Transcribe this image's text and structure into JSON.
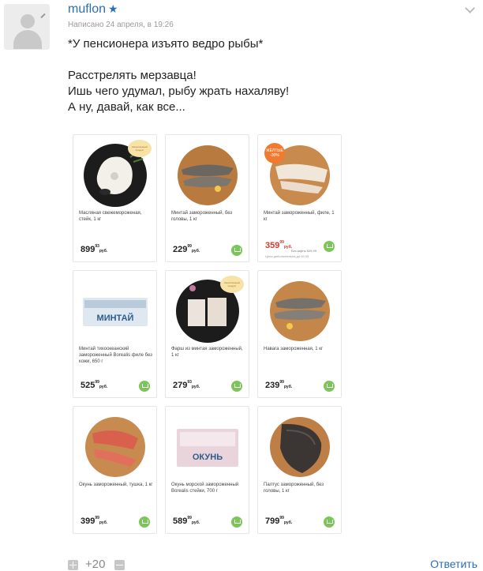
{
  "comment": {
    "author": "muflon",
    "star_icon": "★",
    "meta": "Написано 24 апреля, в 19:26",
    "lines": [
      "*У пенсионера изъято ведро рыбы*",
      "Расстрелять мерзавца!",
      "Ишь чего удумал, рыбу жрать нахаляву!",
      "А ну, давай, как все..."
    ],
    "score": "+20",
    "reply_label": "Ответить"
  },
  "products": [
    {
      "name": "Масляная свежемороженая, стейк, 1 кг",
      "price_main": "899",
      "price_kop": "93",
      "currency": "руб.",
      "tag": "Качественный продукт"
    },
    {
      "name": "Минтай замороженный, без головы, 1 кг",
      "price_main": "229",
      "price_kop": "99",
      "currency": "руб."
    },
    {
      "name": "Минтай замороженный, филе, 1 кг",
      "price_main": "359",
      "price_kop": "99",
      "currency": "руб.",
      "old_price": "Без карты 529,99",
      "note": "Цена действительна до 00.05",
      "badge_top": "ЖЁЛТЫЕ",
      "badge_bottom": "-30%"
    },
    {
      "name": "Минтай тихоокеанский замороженный Borealis филе без кожи, 650 г",
      "price_main": "525",
      "price_kop": "99",
      "currency": "руб.",
      "label": "МИНТАЙ"
    },
    {
      "name": "Фарш из минтая замороженный, 1 кг",
      "price_main": "279",
      "price_kop": "93",
      "currency": "руб.",
      "tag": "Качественный продукт"
    },
    {
      "name": "Навага замороженная, 1 кг",
      "price_main": "239",
      "price_kop": "99",
      "currency": "руб."
    },
    {
      "name": "Окунь замороженный, тушка, 1 кг",
      "price_main": "399",
      "price_kop": "99",
      "currency": "руб."
    },
    {
      "name": "Окунь морской замороженный Borealis стейки, 700 г",
      "price_main": "589",
      "price_kop": "99",
      "currency": "руб.",
      "label": "ОКУНЬ"
    },
    {
      "name": "Палтус замороженный, без головы, 1 кг",
      "price_main": "799",
      "price_kop": "99",
      "currency": "руб."
    }
  ]
}
